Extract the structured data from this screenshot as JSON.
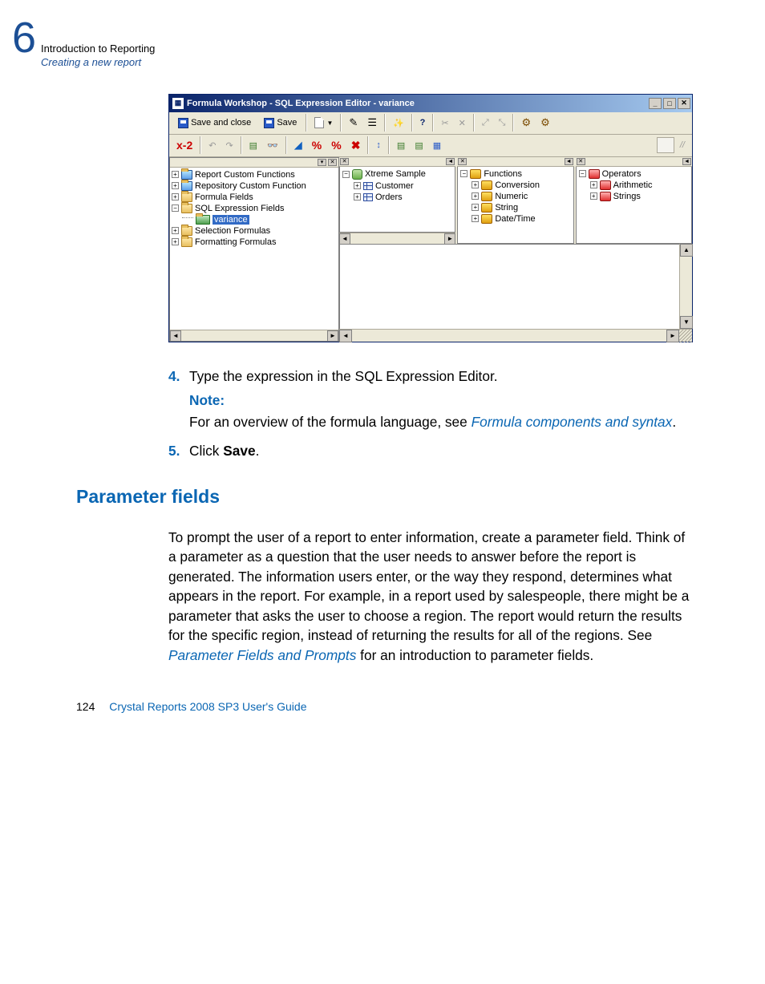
{
  "header": {
    "chapter_number": "6",
    "title": "Introduction to Reporting",
    "subtitle": "Creating a new report"
  },
  "window": {
    "title": "Formula Workshop - SQL Expression Editor - variance",
    "toolbar1": {
      "save_and_close": "Save and close",
      "save": "Save",
      "help": "?"
    },
    "toolbar2": {
      "xy": "x-2",
      "slashes": "//"
    },
    "left_tree": {
      "items": [
        {
          "label": "Report Custom Functions",
          "expand": "+"
        },
        {
          "label": "Repository Custom Function",
          "expand": "+"
        },
        {
          "label": "Formula Fields",
          "expand": "+"
        },
        {
          "label": "SQL Expression Fields",
          "expand": "−",
          "children": [
            {
              "label": "variance",
              "selected": true
            }
          ]
        },
        {
          "label": "Selection Formulas",
          "expand": "+"
        },
        {
          "label": "Formatting Formulas",
          "expand": "+"
        }
      ]
    },
    "pane1": {
      "root": "Xtreme Sample",
      "rows": [
        {
          "label": "Customer",
          "expand": "+"
        },
        {
          "label": "Orders",
          "expand": "+"
        }
      ]
    },
    "pane2": {
      "root": "Functions",
      "rows": [
        {
          "label": "Conversion",
          "expand": "+"
        },
        {
          "label": "Numeric",
          "expand": "+"
        },
        {
          "label": "String",
          "expand": "+"
        },
        {
          "label": "Date/Time",
          "expand": "+"
        }
      ]
    },
    "pane3": {
      "root": "Operators",
      "rows": [
        {
          "label": "Arithmetic",
          "expand": "+"
        },
        {
          "label": "Strings",
          "expand": "+"
        }
      ]
    }
  },
  "steps": {
    "s4_num": "4.",
    "s4_text": "Type the expression in the SQL Expression Editor.",
    "note_label": "Note:",
    "note_prefix": "For an overview of the formula language, see ",
    "note_link": "Formula components and syntax",
    "note_suffix": ".",
    "s5_num": "5.",
    "s5_text_a": "Click ",
    "s5_text_b": "Save",
    "s5_text_c": "."
  },
  "section_head": "Parameter fields",
  "para_prefix": "To prompt the user of a report to enter information, create a parameter field. Think of a parameter as a question that the user needs to answer before the report is generated. The information users enter, or the way they respond, determines what appears in the report. For example, in a report used by salespeople, there might be a parameter that asks the user to choose a region. The report would return the results for the specific region, instead of returning the results for all of the regions. See ",
  "para_link": "Parameter Fields and Prompts",
  "para_suffix": " for an introduction to parameter fields.",
  "footer": {
    "page": "124",
    "text": "Crystal Reports 2008 SP3 User's Guide"
  }
}
